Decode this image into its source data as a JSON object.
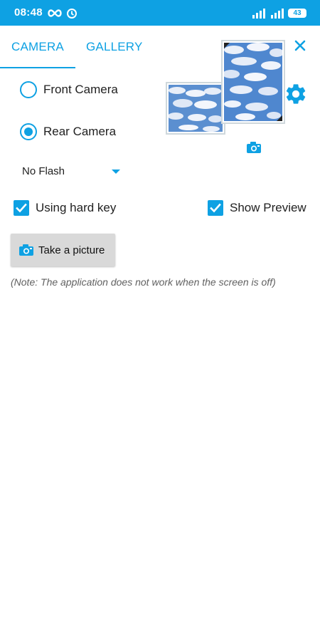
{
  "status_bar": {
    "time": "08:48",
    "battery": "43",
    "icons": [
      "infinity-icon",
      "alarm-icon",
      "signal-icon",
      "signal-icon",
      "battery-icon"
    ]
  },
  "tabs": [
    {
      "label": "CAMERA",
      "selected": true
    },
    {
      "label": "GALLERY",
      "selected": false
    }
  ],
  "camera_options": {
    "front_label": "Front Camera",
    "rear_label": "Rear Camera",
    "selected": "rear"
  },
  "flash": {
    "selected": "No Flash"
  },
  "checkboxes": {
    "hard_key_label": "Using hard key",
    "hard_key_checked": true,
    "preview_label": "Show Preview",
    "preview_checked": true
  },
  "take_picture_label": "Take a picture",
  "note": "(Note: The application does not work when the screen is off)",
  "colors": {
    "accent": "#0ea1e3",
    "status_bar": "#0ea1e3",
    "button_bg": "#d9d9d9",
    "note_text": "#616161"
  }
}
